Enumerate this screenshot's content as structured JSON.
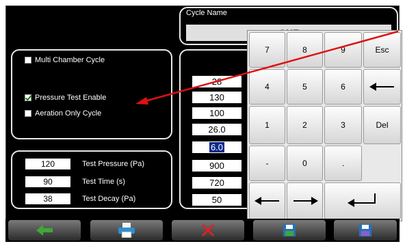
{
  "cycle": {
    "label": "Cycle Name",
    "value": "QHF"
  },
  "options": [
    {
      "label": "Multi Chamber Cycle",
      "checked": false
    },
    {
      "label": "Pressure Test Enable",
      "checked": true
    },
    {
      "label": "Aeration Only Cycle",
      "checked": false
    }
  ],
  "test_params": [
    {
      "value": "120",
      "label": "Test Pressure (Pa)"
    },
    {
      "value": "90",
      "label": "Test Time (s)"
    },
    {
      "value": "38",
      "label": "Test Decay (Pa)"
    }
  ],
  "fields": [
    "28",
    "130",
    "100",
    "26.0",
    "6.0",
    "900",
    "720",
    "50"
  ],
  "selected_field_index": 4,
  "keypad": {
    "row1": [
      "7",
      "8",
      "9",
      "Esc"
    ],
    "row2": [
      "4",
      "5",
      "6"
    ],
    "row3": [
      "1",
      "2",
      "3",
      "Del"
    ],
    "row4": [
      "-",
      "0",
      "."
    ]
  },
  "icons": {
    "back": "arrow-left-green-icon",
    "print": "printer-icon",
    "cancel": "red-x-icon",
    "save": "save-disk-icon",
    "save_as": "save-as-disk-icon",
    "backspace": "backspace-arrow-icon",
    "cursor_left": "arrow-left-icon",
    "cursor_right": "arrow-right-icon",
    "enter": "enter-return-icon"
  },
  "colors": {
    "annotation_arrow": "#e01010",
    "toolbar_back_arrow": "#3fa935",
    "cancel_x": "#e02020",
    "selection": "#0a2a8a"
  }
}
